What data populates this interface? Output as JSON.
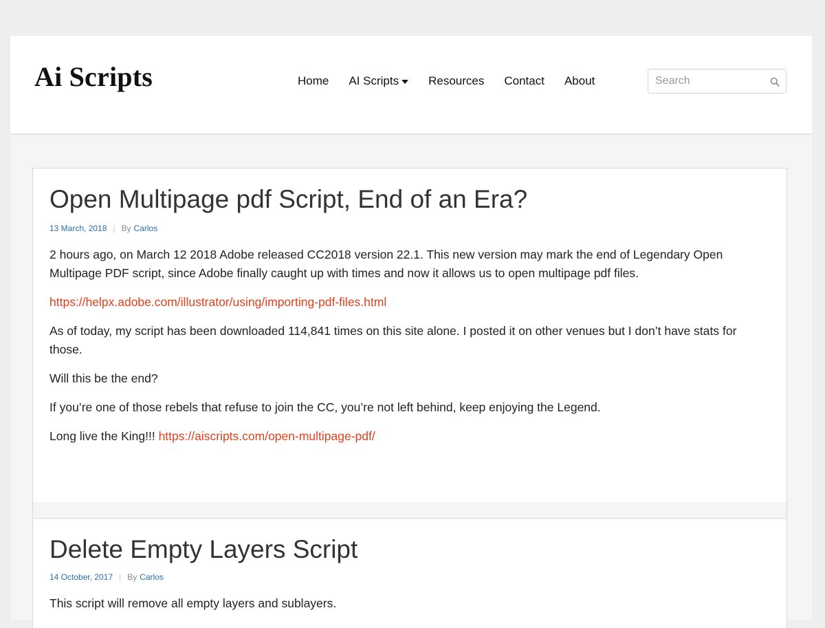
{
  "site": {
    "logo": "Ai Scripts"
  },
  "nav": {
    "items": [
      {
        "label": "Home"
      },
      {
        "label": "AI Scripts",
        "has_dropdown": true
      },
      {
        "label": "Resources"
      },
      {
        "label": "Contact"
      },
      {
        "label": "About"
      }
    ]
  },
  "search": {
    "placeholder": "Search",
    "icon": "search-icon"
  },
  "posts": [
    {
      "title": "Open Multipage pdf Script, End of an Era?",
      "date": "13 March, 2018",
      "by": "By",
      "author": "Carlos",
      "p1": "2 hours ago, on March 12 2018 Adobe released CC2018 version 22.1. This new version may mark the end of Legendary Open Multipage PDF script, since Adobe finally caught up with times and now it allows us to open multipage pdf files.",
      "link1": "https://helpx.adobe.com/illustrator/using/importing-pdf-files.html",
      "p2": "As of today, my script has been downloaded 114,841 times on this site alone. I posted it on other venues but I don’t have stats for those.",
      "p3": "Will this be the end?",
      "p4": "If you’re one of those rebels that refuse to join the CC, you’re not left behind, keep enjoying the Legend.",
      "p5_text": "Long live the King!!! ",
      "p5_link": "https://aiscripts.com/open-multipage-pdf/"
    },
    {
      "title": "Delete Empty Layers Script",
      "date": "14 October, 2017",
      "by": "By",
      "author": "Carlos",
      "p1": "This script will remove all empty layers and sublayers."
    }
  ],
  "colors": {
    "link": "#e0401e",
    "meta_link": "#2a6db0",
    "page_bg": "#eeeeee",
    "content_bg": "#f5f5f5"
  }
}
